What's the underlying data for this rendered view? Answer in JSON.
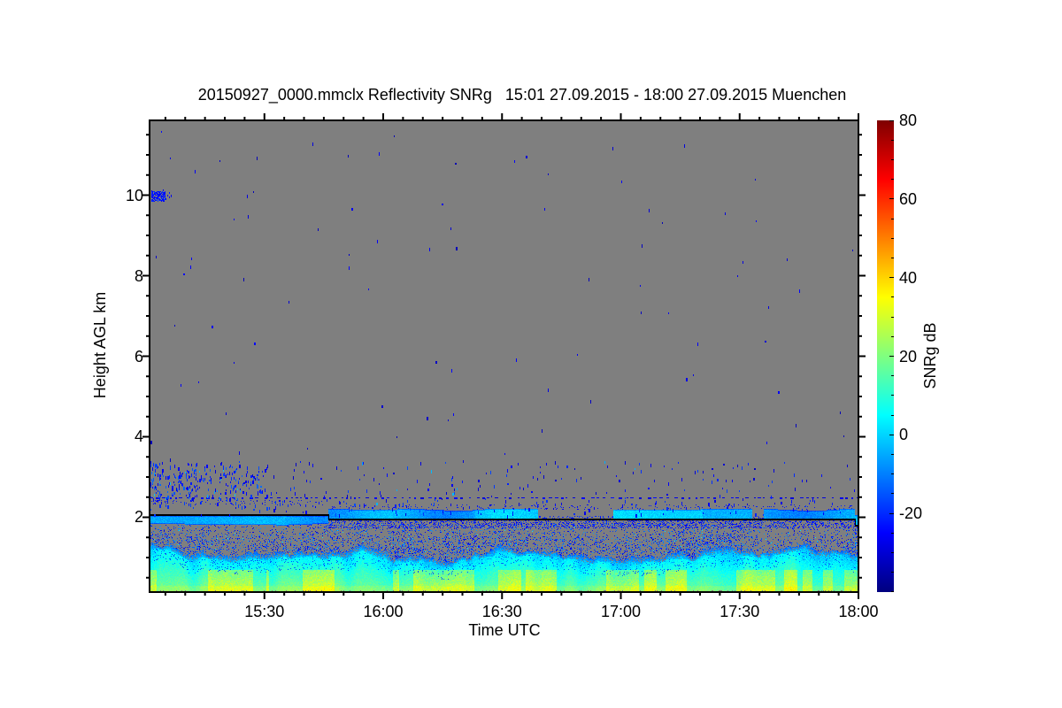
{
  "title": "20150927_0000.mmclx Reflectivity SNRg   15:01 27.09.2015 - 18:00 27.09.2015 Muenchen",
  "chart_data": {
    "type": "heatmap",
    "title": "20150927_0000.mmclx Reflectivity SNRg   15:01 27.09.2015 - 18:00 27.09.2015 Muenchen",
    "instrument": "20150927_0000.mmclx",
    "quantity": "Reflectivity SNRg",
    "time_span": "15:01 27.09.2015 - 18:00 27.09.2015",
    "site": "Muenchen",
    "xlabel": "Time UTC",
    "ylabel": "Height AGL km",
    "zlabel": "SNRg dB",
    "x_range_utc": [
      "15:01",
      "18:00"
    ],
    "x_duration_min": 179,
    "x_ticks": [
      {
        "label": "15:30",
        "minutes": 29
      },
      {
        "label": "16:00",
        "minutes": 59
      },
      {
        "label": "16:30",
        "minutes": 89
      },
      {
        "label": "17:00",
        "minutes": 119
      },
      {
        "label": "17:30",
        "minutes": 149
      },
      {
        "label": "18:00",
        "minutes": 179
      }
    ],
    "x_minor_tick_min": 5,
    "y_range_km": [
      0.14,
      11.86
    ],
    "y_ticks": [
      {
        "label": "2",
        "km": 2
      },
      {
        "label": "4",
        "km": 4
      },
      {
        "label": "6",
        "km": 6
      },
      {
        "label": "8",
        "km": 8
      },
      {
        "label": "10",
        "km": 10
      }
    ],
    "y_minor_tick_km": 0.5,
    "colorbar": {
      "label": "SNRg dB",
      "range_db": [
        -40,
        80
      ],
      "ticks": [
        {
          "label": "80",
          "db": 80
        },
        {
          "label": "60",
          "db": 60
        },
        {
          "label": "40",
          "db": 40
        },
        {
          "label": "20",
          "db": 20
        },
        {
          "label": "0",
          "db": 0
        },
        {
          "label": "-20",
          "db": -20
        }
      ],
      "minor_tick_db": 5,
      "colormap": "jet",
      "nodata_color_rgb": [
        127,
        127,
        127
      ]
    },
    "seed": 20150927,
    "features": [
      {
        "name": "no-signal-background",
        "type": "fill",
        "value_db": null
      },
      {
        "name": "upper-noise-speckles",
        "type": "speckle",
        "height_km": [
          2.75,
          11.8
        ],
        "count": 95,
        "value_db": [
          -34,
          -24
        ]
      },
      {
        "name": "speckle-layer-2to3km",
        "type": "speckle",
        "height_km": [
          2.2,
          3.4
        ],
        "count": 260,
        "value_db": [
          -32,
          -16
        ],
        "left_weighted": true
      },
      {
        "name": "left-edge-cluster",
        "type": "speckle",
        "time_min": [
          0,
          30
        ],
        "height_km": [
          2.45,
          3.35
        ],
        "count": 230,
        "value_db": [
          -30,
          -12
        ]
      },
      {
        "name": "cloud-patch-10km",
        "type": "patch",
        "time_min": [
          0.5,
          4.0
        ],
        "height_km": [
          9.84,
          10.08
        ],
        "value_db": [
          -28,
          -18
        ]
      },
      {
        "name": "dotted-plankton-line",
        "type": "dotted-line",
        "height_km": 2.48,
        "value_db": -27
      },
      {
        "name": "pbl-top-line",
        "type": "stepped-line",
        "color": "#000000",
        "segments": [
          {
            "time_min": [
              0,
              45
            ],
            "height_km": 2.07
          },
          {
            "time_min": [
              45,
              178
            ],
            "height_km": 1.95
          },
          {
            "time_min": [
              178,
              179
            ],
            "height_km": 1.8
          }
        ]
      },
      {
        "name": "lid-echo-band",
        "type": "band",
        "height_km": [
          1.85,
          2.1
        ],
        "gaps_min": [
          [
            98,
            117
          ],
          [
            152,
            155
          ]
        ],
        "value_db": [
          -16,
          2
        ]
      },
      {
        "name": "below-line-fringe",
        "type": "speckle-rows",
        "height_km": [
          1.72,
          1.95
        ],
        "prob": 0.3,
        "value_db": [
          -28,
          -16
        ]
      },
      {
        "name": "sub-dotted-speckles",
        "type": "speckle",
        "height_km": [
          2.05,
          2.45
        ],
        "count": 120,
        "value_db": [
          -30,
          -16
        ]
      },
      {
        "name": "streak-zone",
        "type": "streaks",
        "height_km": [
          0.9,
          1.82
        ],
        "value_db": [
          -30,
          -6
        ]
      },
      {
        "name": "boundary-layer",
        "type": "filled-gradient",
        "top_km_mean": 0.8,
        "top_km_amplitude": 0.32,
        "value_db": [
          2,
          24
        ],
        "patch_value_db": [
          24,
          36
        ]
      }
    ]
  }
}
